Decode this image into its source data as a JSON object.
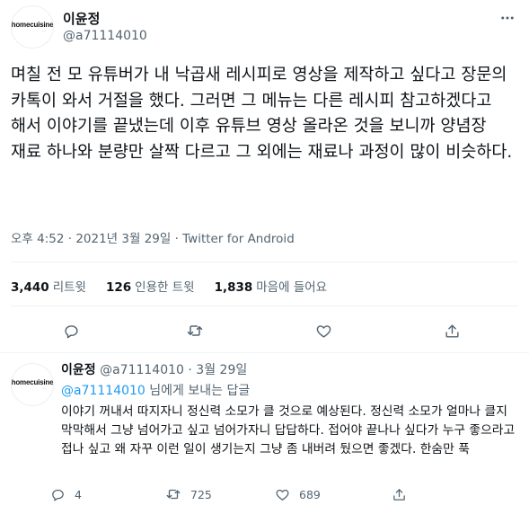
{
  "main": {
    "author_name": "이윤정",
    "author_handle": "@a71114010",
    "avatar_brand": "homecuisine",
    "avatar_brand_sub": "⋯",
    "text": "며칠 전 모 유튜버가 내 낙곱새 레시피로 영상을 제작하고 싶다고 장문의 카톡이 와서 거절을 했다. 그러면 그 메뉴는 다른 레시피 참고하겠다고 해서 이야기를 끝냈는데 이후 유튜브 영상 올라온 것을 보니까 양념장 재료 하나와 분량만 살짝 다르고 그 외에는 재료나 과정이 많이 비슷하다.",
    "time": "오후 4:52",
    "date": "2021년 3월 29일",
    "source": "Twitter for Android",
    "stats": {
      "retweets": "3,440",
      "retweets_label": "리트윗",
      "quotes": "126",
      "quotes_label": "인용한 트윗",
      "likes": "1,838",
      "likes_label": "마음에 들어요"
    }
  },
  "reply": {
    "author_name": "이윤정",
    "author_handle": "@a71114010",
    "date": "3월 29일",
    "replying_to": "@a71114010",
    "replying_suffix": " 님에게 보내는 답글",
    "text": "이야기 꺼내서 따지자니 정신력 소모가 클 것으로 예상된다. 정신력 소모가 얼마나 클지 막막해서 그냥 넘어가고 싶고 넘어가자니 답답하다. 접어야 끝나나 싶다가 누구 좋으라고 접나 싶고 왜 자꾸 이런 일이 생기는지 그냥 좀 내버려 뒀으면 좋겠다. 한숨만 푹",
    "counts": {
      "replies": "4",
      "retweets": "725",
      "likes": "689"
    }
  },
  "icons": {
    "more": "more-dots-icon",
    "reply": "reply-bubble-icon",
    "retweet": "retweet-icon",
    "like": "heart-icon",
    "share": "share-icon"
  }
}
